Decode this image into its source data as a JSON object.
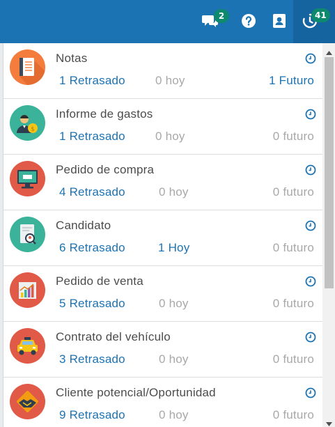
{
  "navbar": {
    "chat_badge": "2",
    "activity_badge": "41",
    "icons": [
      "chat-icon",
      "help-icon",
      "contacts-icon",
      "activity-clock-icon"
    ],
    "bg_color": "#1c73b3",
    "badge_color": "#0d8a6e"
  },
  "activities": [
    {
      "title": "Notas",
      "late": "1 Retrasado",
      "today": "0 hoy",
      "future": "1 Futuro",
      "icon": "notes-icon",
      "icon_color": "#f47c3c"
    },
    {
      "title": "Informe de gastos",
      "late": "1 Retrasado",
      "today": "0 hoy",
      "future": "0 futuro",
      "icon": "expense-report-icon",
      "icon_color": "#3bb39a"
    },
    {
      "title": "Pedido de compra",
      "late": "4 Retrasado",
      "today": "0 hoy",
      "future": "0 futuro",
      "icon": "purchase-order-icon",
      "icon_color": "#e05a47"
    },
    {
      "title": "Candidato",
      "late": "6 Retrasado",
      "today": "1 Hoy",
      "future": "0 futuro",
      "icon": "candidate-icon",
      "icon_color": "#3bb39a"
    },
    {
      "title": "Pedido de venta",
      "late": "5 Retrasado",
      "today": "0 hoy",
      "future": "0 futuro",
      "icon": "sales-order-icon",
      "icon_color": "#e05a47"
    },
    {
      "title": "Contrato del vehículo",
      "late": "3 Retrasado",
      "today": "0 hoy",
      "future": "0 futuro",
      "icon": "vehicle-contract-icon",
      "icon_color": "#e05a47"
    },
    {
      "title": "Cliente potencial/Oportunidad",
      "late": "9 Retrasado",
      "today": "0 hoy",
      "future": "0 futuro",
      "icon": "lead-opportunity-icon",
      "icon_color": "#e05a47"
    }
  ]
}
